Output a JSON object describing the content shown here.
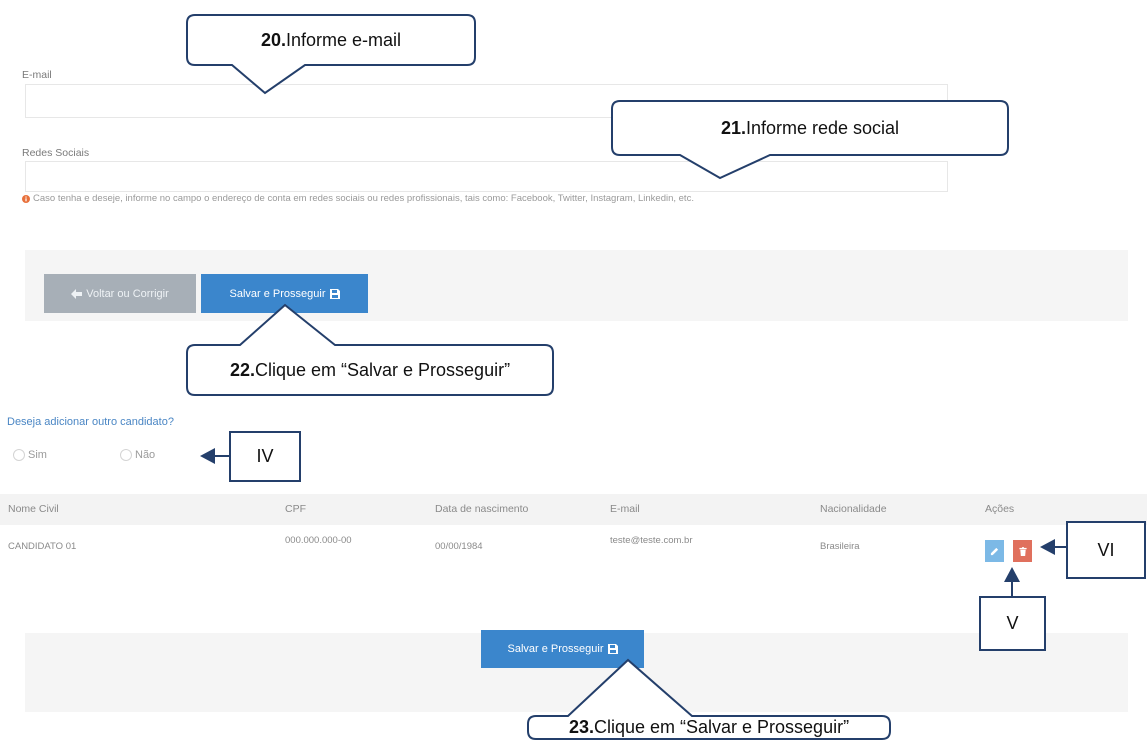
{
  "callouts": [
    {
      "number": "20.",
      "text": "Informe e-mail"
    },
    {
      "number": "21.",
      "text": "Informe rede social"
    },
    {
      "number": "22.",
      "text": "Clique em “Salvar e Prosseguir”"
    },
    {
      "number": "23.",
      "text": "Clique em “Salvar e Prosseguir”"
    }
  ],
  "markers": {
    "iv": "IV",
    "v": "V",
    "vi": "VI"
  },
  "form": {
    "email": {
      "label": "E-mail",
      "value": ""
    },
    "social": {
      "label": "Redes Sociais",
      "value": "",
      "help_icon": "info-icon",
      "help": "Caso tenha e deseje, informe no campo o endereço de conta em redes sociais ou redes profissionais, tais como: Facebook, Twitter, Instagram, Linkedin, etc."
    }
  },
  "actions_top": {
    "back": {
      "label": "Voltar ou Corrigir",
      "icon": "arrow-left-icon"
    },
    "save": {
      "label": "Salvar e Prosseguir",
      "icon": "save-icon"
    }
  },
  "question": {
    "text": "Deseja adicionar outro candidato?",
    "options": [
      {
        "label": "Sim",
        "checked": false
      },
      {
        "label": "Não",
        "checked": false
      }
    ]
  },
  "table": {
    "headers": [
      "Nome Civil",
      "CPF",
      "Data de nascimento",
      "E-mail",
      "Nacionalidade",
      "Ações"
    ],
    "rows": [
      {
        "cells": [
          "CANDIDATO 01",
          "000.000.000-00",
          "00/00/1984",
          "teste@teste.com.br",
          "Brasileira"
        ],
        "edit_icon": "pencil-icon",
        "delete_icon": "trash-icon"
      }
    ]
  },
  "actions_bottom": {
    "save": {
      "label": "Salvar e Prosseguir",
      "icon": "save-icon"
    }
  },
  "colors": {
    "callout_border": "#243f6b",
    "primary": "#3b86cc",
    "secondary": "#a7afb7",
    "edit": "#7cb9e6",
    "delete": "#e0705d",
    "info": "#e8713c",
    "question": "#4a86c4",
    "panel": "#f5f5f5"
  }
}
